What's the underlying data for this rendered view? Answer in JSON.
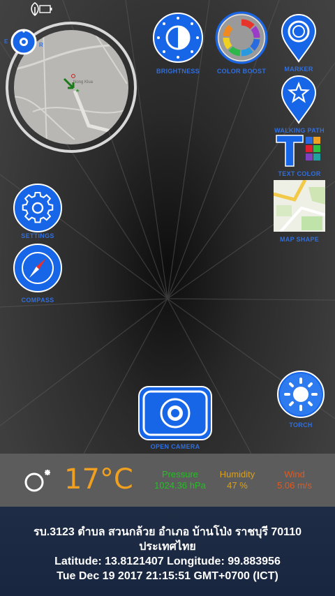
{
  "status": {
    "icons": [
      "leaf-icon",
      "battery-icon"
    ]
  },
  "map": {
    "place_label": "Nong Klua",
    "compass_letters": [
      "E",
      "R"
    ]
  },
  "buttons": {
    "brightness": "BRIGHTNESS",
    "color_boost": "COLOR BOOST",
    "marker": "MARKER",
    "walking_path": "WALKING PATH",
    "text_color": "TEXT COLOR",
    "map_shape": "MAP SHAPE",
    "settings": "SETTINGS",
    "compass": "COMPASS",
    "torch": "TORCH",
    "open_camera": "OPEN CAMERA"
  },
  "weather": {
    "temperature": "17°C",
    "pressure_label": "Pressure",
    "pressure_value": "1024.36 hPa",
    "humidity_label": "Humidity",
    "humidity_value": "47 %",
    "wind_label": "Wind",
    "wind_value": "5.06 m/s"
  },
  "address": {
    "line1": "รบ.3123 ตำบล สวนกล้วย อำเภอ บ้านโป่ง ราชบุรี 70110",
    "line2": "ประเทศไทย",
    "coords": "Latitude: 13.8121407 Longitude: 99.883956",
    "datetime": "Tue Dec 19 2017 21:15:51 GMT+0700 (ICT)"
  },
  "colors": {
    "accent_blue": "#1866e8",
    "label_blue": "#2f6fe0",
    "temp_orange": "#f0a020",
    "pressure_green": "#22c022",
    "humidity_gold": "#d8a020",
    "wind_orange": "#e05a20"
  }
}
